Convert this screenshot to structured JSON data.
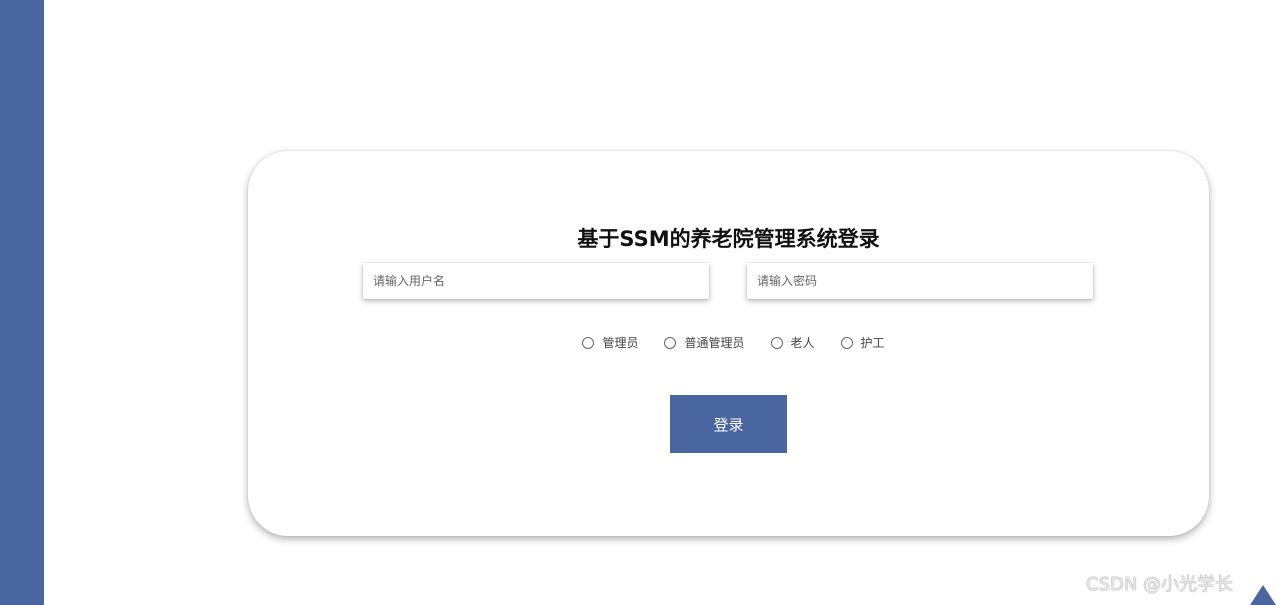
{
  "login": {
    "title": "基于SSM的养老院管理系统登录",
    "username_placeholder": "请输入用户名",
    "password_placeholder": "请输入密码",
    "roles": [
      "管理员",
      "普通管理员",
      "老人",
      "护工"
    ],
    "button_label": "登录"
  },
  "watermark": "CSDN @小光学长",
  "colors": {
    "accent": "#4a66a0",
    "background": "#ffffff"
  }
}
